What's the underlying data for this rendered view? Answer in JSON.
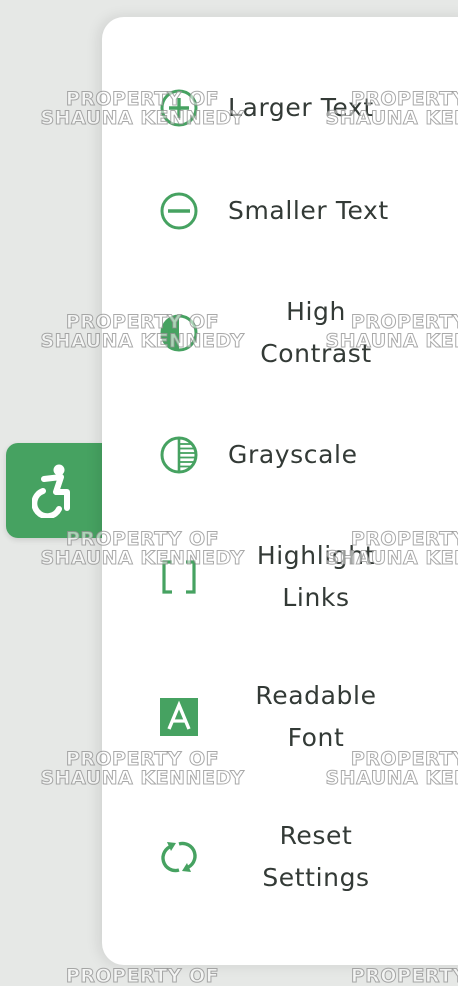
{
  "toggle": {
    "icon": "accessibility-icon"
  },
  "menu": {
    "items": [
      {
        "label": "Larger Text",
        "icon": "zoom-in-circle-icon"
      },
      {
        "label": "Smaller Text",
        "icon": "zoom-out-circle-icon"
      },
      {
        "line1": "High",
        "line2": "Contrast",
        "icon": "contrast-half-circle-icon"
      },
      {
        "label": "Grayscale",
        "icon": "grayscale-striped-circle-icon"
      },
      {
        "line1": "Highlight",
        "line2": "Links",
        "icon": "brackets-icon"
      },
      {
        "line1": "Readable",
        "line2": "Font",
        "icon": "font-letter-a-icon"
      },
      {
        "line1": "Reset",
        "line2": "Settings",
        "icon": "reset-arrows-icon"
      }
    ]
  },
  "watermark": {
    "line1": "PROPERTY OF",
    "line2": "SHAUNA KENNEDY"
  },
  "colors": {
    "accent": "#46a261",
    "text": "#333a36",
    "panel": "#ffffff",
    "background": "#e6e8e6"
  }
}
